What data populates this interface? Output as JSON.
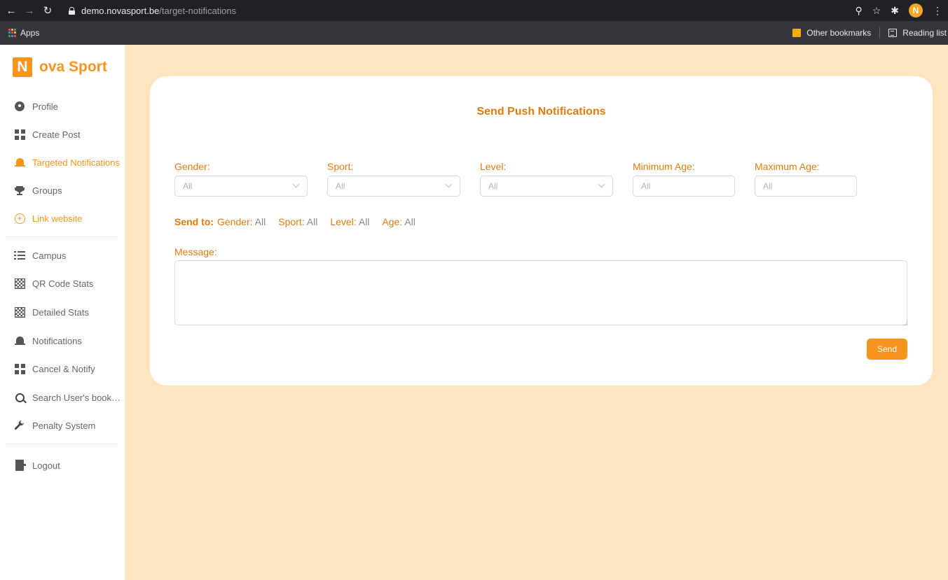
{
  "browser": {
    "url_host": "demo.novasport.be",
    "url_path": "/target-notifications",
    "profile_initial": "N",
    "bookmarks": {
      "apps_label": "Apps",
      "other_bookmarks": "Other bookmarks",
      "reading_list": "Reading list"
    }
  },
  "sidebar": {
    "logo_letter": "N",
    "logo_text": "ova Sport",
    "items": [
      {
        "label": "Profile",
        "icon": "user-icon"
      },
      {
        "label": "Create Post",
        "icon": "grid-icon"
      },
      {
        "label": "Targeted Notifications",
        "icon": "bell-icon",
        "active": true
      },
      {
        "label": "Groups",
        "icon": "trophy-icon"
      },
      {
        "label": "Link website",
        "icon": "plus-circle-icon"
      },
      {
        "label": "Campus",
        "icon": "list-icon"
      },
      {
        "label": "QR Code Stats",
        "icon": "qr-icon"
      },
      {
        "label": "Detailed Stats",
        "icon": "qr-icon"
      },
      {
        "label": "Notifications",
        "icon": "bell-icon"
      },
      {
        "label": "Cancel & Notify",
        "icon": "grid-icon"
      },
      {
        "label": "Search User's bookings",
        "icon": "search-icon"
      },
      {
        "label": "Penalty System",
        "icon": "wrench-icon"
      },
      {
        "label": "Logout",
        "icon": "logout-icon"
      }
    ]
  },
  "main": {
    "title": "Send Push Notifications",
    "filters": {
      "gender": {
        "label": "Gender:",
        "value": "All"
      },
      "sport": {
        "label": "Sport:",
        "value": "All"
      },
      "level": {
        "label": "Level:",
        "value": "All"
      },
      "min_age": {
        "label": "Minimum Age:",
        "placeholder": "All"
      },
      "max_age": {
        "label": "Maximum Age:",
        "placeholder": "All"
      }
    },
    "send_to": {
      "label": "Send to:",
      "gender_key": "Gender:",
      "gender_val": "All",
      "sport_key": "Sport:",
      "sport_val": "All",
      "level_key": "Level:",
      "level_val": "All",
      "age_key": "Age:",
      "age_val": "All"
    },
    "message_label": "Message:",
    "message_value": "",
    "send_label": "Send"
  },
  "colors": {
    "accent": "#f7941d",
    "accent_text": "#e07b10",
    "page_bg": "#ffe4c0"
  }
}
